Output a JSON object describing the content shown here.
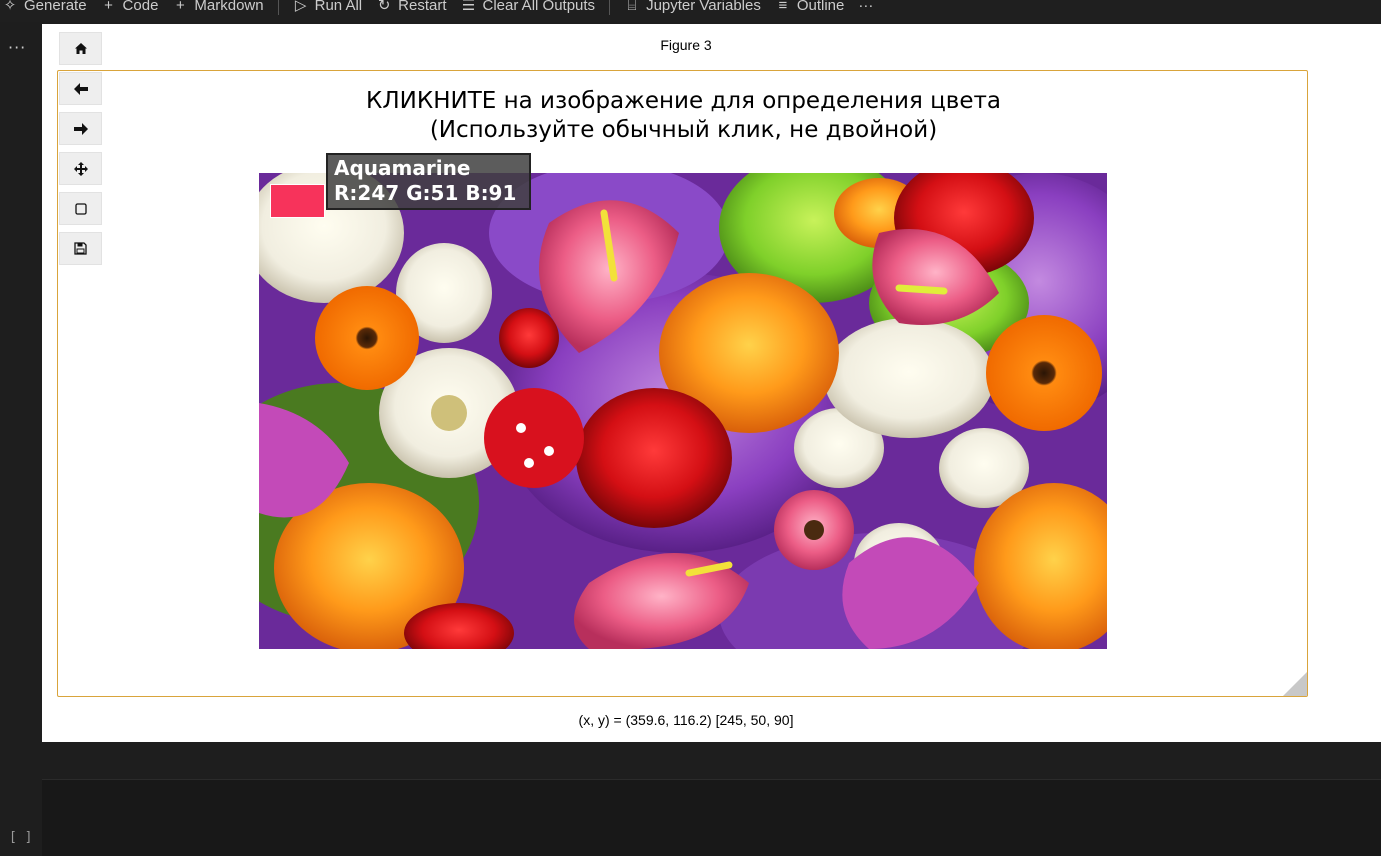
{
  "toolbar": {
    "items": [
      {
        "icon": "sparkle-icon",
        "label": "Generate"
      },
      {
        "icon": "plus-icon",
        "label": "Code"
      },
      {
        "icon": "plus-icon",
        "label": "Markdown"
      },
      {
        "icon": "run-all-icon",
        "label": "Run All"
      },
      {
        "icon": "restart-icon",
        "label": "Restart"
      },
      {
        "icon": "clear-outputs-icon",
        "label": "Clear All Outputs"
      },
      {
        "icon": "variables-icon",
        "label": "Jupyter Variables"
      },
      {
        "icon": "outline-icon",
        "label": "Outline"
      }
    ],
    "more_label": "···"
  },
  "gutter": {
    "dots": "···",
    "cell_brackets": "[ ]"
  },
  "figure": {
    "title": "Figure 3",
    "plot_title_line1": "КЛИКНИТЕ на изображение для определения цвета",
    "plot_title_line2": "(Используйте обычный клик, не двойной)",
    "color_name": "Aquamarine",
    "rgb_text": "R:247 G:51 B:91",
    "swatch_color": "#f7335b",
    "status": "(x, y) = (359.6, 116.2) [245, 50, 90]",
    "nav_buttons": [
      {
        "name": "home-button",
        "icon": "home-icon"
      },
      {
        "name": "back-button",
        "icon": "arrow-left-icon"
      },
      {
        "name": "forward-button",
        "icon": "arrow-right-icon"
      },
      {
        "name": "pan-button",
        "icon": "move-icon"
      },
      {
        "name": "zoom-button",
        "icon": "zoom-rect-icon"
      },
      {
        "name": "save-button",
        "icon": "save-icon"
      }
    ]
  },
  "colors": {
    "frame_border": "#d9a43b",
    "toolbar_bg": "#1f1f1f",
    "editor_bg": "#1e1e1e"
  }
}
